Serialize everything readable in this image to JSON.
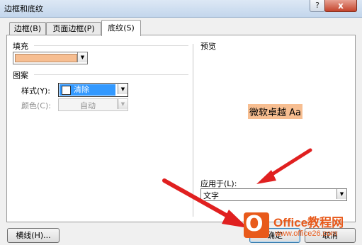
{
  "window": {
    "title": "边框和底纹",
    "help_glyph": "?",
    "close_glyph": "x"
  },
  "tabs": [
    {
      "label": "边框(B)"
    },
    {
      "label": "页面边框(P)"
    },
    {
      "label": "底纹(S)"
    }
  ],
  "fill": {
    "label": "填充",
    "color": "#f7be91"
  },
  "pattern": {
    "label": "图案",
    "style_label": "样式(Y):",
    "style_value": "清除",
    "color_label": "颜色(C):",
    "color_value": "自动"
  },
  "preview": {
    "label": "预览",
    "sample_text": "微软卓越 Aa"
  },
  "apply": {
    "label": "应用于(L):",
    "value": "文字"
  },
  "buttons": {
    "horizontal_line": "横线(H)...",
    "ok": "确定",
    "cancel": "取消"
  },
  "watermark": {
    "glyph": "O",
    "line1": "Office教程网",
    "line2": "www.office26.com"
  },
  "colors": {
    "selection": "#3399ff",
    "annotation_arrow": "#e02020",
    "watermark": "#e85a1b"
  }
}
